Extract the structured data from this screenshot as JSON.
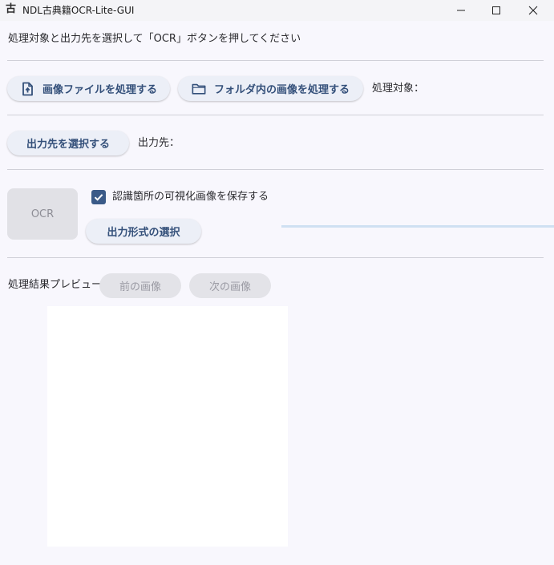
{
  "window": {
    "title": "NDL古典籍OCR-Lite-GUI",
    "icon": "app-logo-icon"
  },
  "instruction": "処理対象と出力先を選択して「OCR」ボタンを押してください",
  "input_section": {
    "image_file_button": "画像ファイルを処理する",
    "folder_button": "フォルダ内の画像を処理する",
    "target_label": "処理対象："
  },
  "output_section": {
    "select_output_button": "出力先を選択する",
    "output_label": "出力先："
  },
  "ocr_section": {
    "ocr_button": "OCR",
    "save_visualization_label": "認識箇所の可視化画像を保存する",
    "save_visualization_checked": true,
    "output_format_button": "出力形式の選択"
  },
  "preview_section": {
    "label": "処理結果プレビュー",
    "prev_button": "前の画像",
    "next_button": "次の画像"
  },
  "colors": {
    "accent": "#34507a",
    "checkbox": "#3a5a88",
    "progress_track": "#cfe0f2"
  }
}
